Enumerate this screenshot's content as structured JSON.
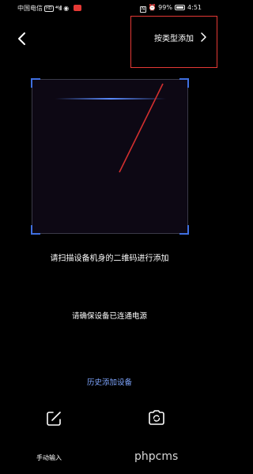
{
  "status_bar": {
    "carrier": "中国电信",
    "hd_badge": "HD",
    "signal": "⁴⁶ıll",
    "wifi": "◉",
    "nfc": "N",
    "alarm": "⏰",
    "battery": "99%",
    "time": "4:51"
  },
  "header": {
    "type_add_label": "按类型添加",
    "highlight_color": "#e53935"
  },
  "scanner": {
    "instruction": "请扫描设备机身的二维码进行添加",
    "corner_color": "#3f6fe0",
    "scan_line_color": "#5a8bff"
  },
  "power_hint": "请确保设备已连通电源",
  "history_link": "历史添加设备",
  "bottom": {
    "manual_input_label": "手动输入"
  },
  "watermark": "phpcms"
}
